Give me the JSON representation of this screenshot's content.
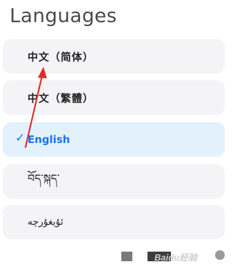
{
  "header": {
    "title": "Languages"
  },
  "languages": [
    {
      "label": "中文（简体）",
      "selected": false
    },
    {
      "label": "中文（繁體）",
      "selected": false
    },
    {
      "label": "English",
      "selected": true
    },
    {
      "label": "བོད་སྐད་",
      "selected": false
    },
    {
      "label": "ئۇيغۇرچە",
      "selected": false
    }
  ],
  "watermark": "Baidu经验",
  "colors": {
    "selected_bg": "#e3f1fc",
    "selected_text": "#1a73e8",
    "arrow": "#e02a2a"
  }
}
